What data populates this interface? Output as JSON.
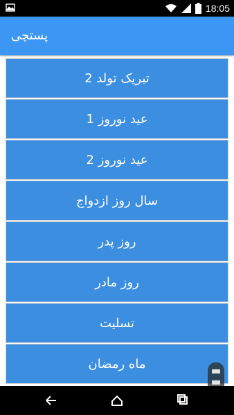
{
  "status": {
    "time": "18:05",
    "icons": [
      "notification-icon",
      "wifi-icon",
      "signal-icon",
      "battery-icon"
    ]
  },
  "appbar": {
    "title": "پستچی"
  },
  "list": {
    "items": [
      "تبریک تولد 2",
      "عید نوروز 1",
      "عید نوروز 2",
      "سال روز ازدواج",
      "روز پدر",
      "روز مادر",
      "تسلیت",
      "ماه رمضان"
    ]
  },
  "navbar": {
    "buttons": [
      "back-icon",
      "home-icon",
      "recents-icon"
    ]
  },
  "colors": {
    "accent": "#3b97f3",
    "list_item": "#3b8ee0",
    "statusbar": "#000000"
  }
}
